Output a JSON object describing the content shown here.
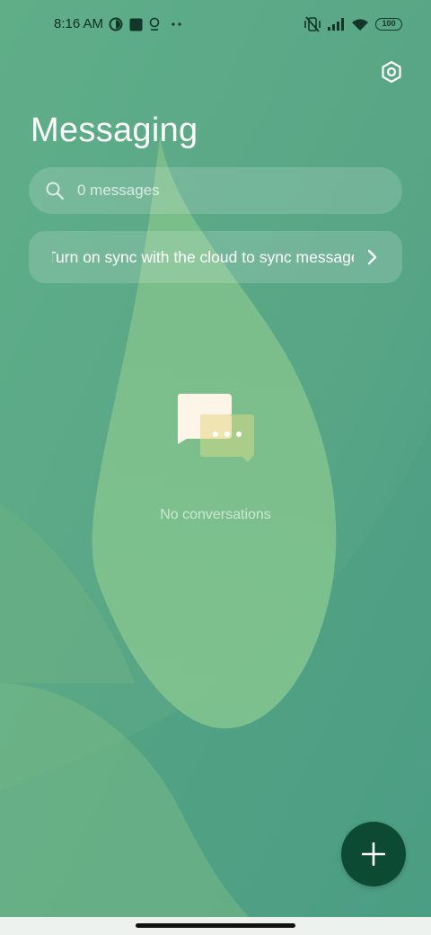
{
  "status_bar": {
    "time": "8:16 AM",
    "battery": "100",
    "icons": [
      "data-saver-icon",
      "square-notification-icon",
      "location-pin-icon",
      "more-notifications-icon",
      "vibrate-off-icon",
      "signal-icon",
      "wifi-icon",
      "battery-icon"
    ]
  },
  "header": {
    "title": "Messaging",
    "settings_icon": "settings-gear-icon"
  },
  "search": {
    "placeholder": "0 messages",
    "value": "",
    "icon": "search-icon"
  },
  "sync_banner": {
    "text": "Turn on sync with the cloud to sync messages",
    "icon": "chevron-right-icon"
  },
  "empty_state": {
    "text": "No conversations",
    "icon": "chat-bubbles-icon"
  },
  "fab": {
    "icon": "plus-icon",
    "color": "#0d4a33"
  },
  "colors": {
    "background": "#5fae8a",
    "accent": "#0d4a33"
  }
}
